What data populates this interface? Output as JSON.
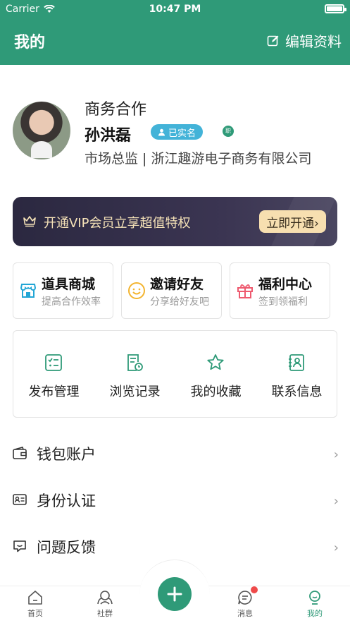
{
  "status": {
    "carrier": "Carrier",
    "time": "10:47 PM"
  },
  "header": {
    "title": "我的",
    "edit_label": "编辑资料"
  },
  "profile": {
    "company_label": "商务合作",
    "name": "孙洪磊",
    "verified_badge": "已实名",
    "job_badge": "职",
    "title_line": "市场总监 | 浙江趣游电子商务有限公司"
  },
  "vip": {
    "text": "开通VIP会员立享超值特权",
    "button": "立即开通›"
  },
  "features": [
    {
      "title": "道具商城",
      "subtitle": "提高合作效率",
      "icon": "shop-icon",
      "color": "#23a6d5"
    },
    {
      "title": "邀请好友",
      "subtitle": "分享给好友吧",
      "icon": "smile-icon",
      "color": "#f3b42f"
    },
    {
      "title": "福利中心",
      "subtitle": "签到领福利",
      "icon": "gift-icon",
      "color": "#ee5a6f"
    }
  ],
  "grid": [
    {
      "label": "发布管理",
      "icon": "checklist-icon"
    },
    {
      "label": "浏览记录",
      "icon": "history-icon"
    },
    {
      "label": "我的收藏",
      "icon": "star-icon"
    },
    {
      "label": "联系信息",
      "icon": "contact-book-icon"
    }
  ],
  "list": [
    {
      "label": "钱包账户",
      "icon": "wallet-icon"
    },
    {
      "label": "身份认证",
      "icon": "id-card-icon"
    },
    {
      "label": "问题反馈",
      "icon": "feedback-icon"
    }
  ],
  "tabs": [
    {
      "label": "首页",
      "icon": "home-icon"
    },
    {
      "label": "社群",
      "icon": "community-icon"
    },
    {
      "label": "消息",
      "icon": "message-icon"
    },
    {
      "label": "我的",
      "icon": "profile-icon"
    }
  ],
  "colors": {
    "brand": "#2f9a78",
    "vip_bg": "#2b2840",
    "vip_text": "#f6e3b8",
    "badge_blue": "#43b3d8",
    "notify_red": "#ef4a4a"
  }
}
